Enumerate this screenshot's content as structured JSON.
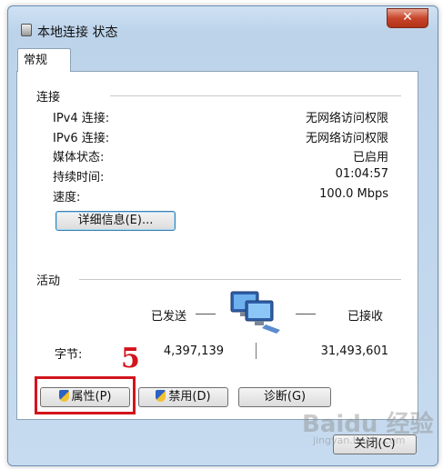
{
  "window": {
    "title": "本地连接 状态",
    "close_glyph": "✕"
  },
  "tab": {
    "label": "常规"
  },
  "connection": {
    "header": "连接",
    "rows": [
      {
        "label": "IPv4 连接:",
        "value": "无网络访问权限"
      },
      {
        "label": "IPv6 连接:",
        "value": "无网络访问权限"
      },
      {
        "label": "媒体状态:",
        "value": "已启用"
      },
      {
        "label": "持续时间:",
        "value": "01:04:57"
      },
      {
        "label": "速度:",
        "value": "100.0 Mbps"
      }
    ],
    "details_button": "详细信息(E)..."
  },
  "activity": {
    "header": "活动",
    "sent_label": "已发送",
    "received_label": "已接收",
    "bytes_label": "字节:",
    "bytes_sent": "4,397,139",
    "bytes_received": "31,493,601"
  },
  "buttons": {
    "properties": "属性(P)",
    "disable": "禁用(D)",
    "diagnose": "诊断(G)",
    "close": "关闭(C)"
  },
  "annotation": {
    "number": "5",
    "color": "#d3141c"
  },
  "watermark": {
    "text": "Baidu 经验",
    "sub": "jingyan.baidu.com"
  }
}
